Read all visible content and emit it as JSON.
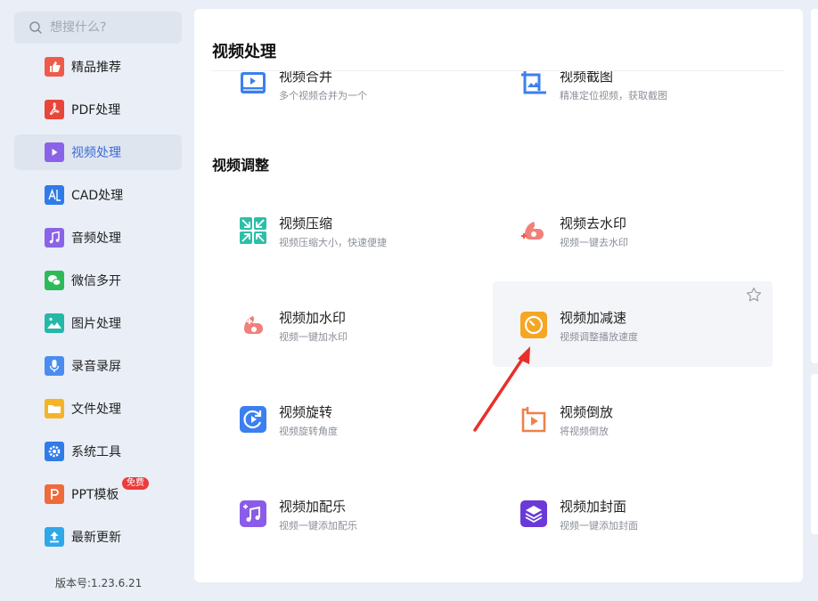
{
  "search": {
    "placeholder": "想搜什么?"
  },
  "sidebar": {
    "items": [
      {
        "label": "精品推荐",
        "icon": "thumbs-up-icon",
        "color": "#f05a4a"
      },
      {
        "label": "PDF处理",
        "icon": "pdf-icon",
        "color": "#e8463a"
      },
      {
        "label": "视频处理",
        "icon": "play-icon",
        "color": "#8a63e8",
        "active": true
      },
      {
        "label": "CAD处理",
        "icon": "cad-icon",
        "color": "#2f7be8"
      },
      {
        "label": "音频处理",
        "icon": "music-note-icon",
        "color": "#8a63e8"
      },
      {
        "label": "微信多开",
        "icon": "wechat-icon",
        "color": "#2fba5a"
      },
      {
        "label": "图片处理",
        "icon": "image-icon",
        "color": "#24b8a8"
      },
      {
        "label": "录音录屏",
        "icon": "microphone-icon",
        "color": "#4a8cf0"
      },
      {
        "label": "文件处理",
        "icon": "folder-icon",
        "color": "#f5b428"
      },
      {
        "label": "系统工具",
        "icon": "gear-icon",
        "color": "#2f7be8"
      },
      {
        "label": "PPT模板",
        "icon": "ppt-icon",
        "color": "#f06a3a",
        "badge": "免费"
      },
      {
        "label": "最新更新",
        "icon": "upload-icon",
        "color": "#2fa8e8"
      }
    ],
    "version": "版本号:1.23.6.21"
  },
  "main": {
    "title": "视频处理",
    "clipped_cards": [
      {
        "name": "视频合并",
        "desc": "多个视频合并为一个",
        "icon": "video-merge-icon"
      },
      {
        "name": "视频截图",
        "desc": "精准定位视频，获取截图",
        "icon": "video-screenshot-icon"
      }
    ],
    "section_title": "视频调整",
    "cards": [
      {
        "name": "视频压缩",
        "desc": "视频压缩大小，快速便捷",
        "icon": "compress-icon"
      },
      {
        "name": "视频去水印",
        "desc": "视频一键去水印",
        "icon": "remove-watermark-icon"
      },
      {
        "name": "视频加水印",
        "desc": "视频一键加水印",
        "icon": "add-watermark-icon"
      },
      {
        "name": "视频加减速",
        "desc": "视频调整播放速度",
        "icon": "speed-icon",
        "hover": true
      },
      {
        "name": "视频旋转",
        "desc": "视频旋转角度",
        "icon": "rotate-icon"
      },
      {
        "name": "视频倒放",
        "desc": "将视频倒放",
        "icon": "reverse-icon"
      },
      {
        "name": "视频加配乐",
        "desc": "视频一键添加配乐",
        "icon": "add-music-icon"
      },
      {
        "name": "视频加封面",
        "desc": "视频一键添加封面",
        "icon": "add-cover-icon"
      }
    ]
  },
  "colors": {
    "accent": "#3a6bd8",
    "annotation_arrow": "#e8302a",
    "background": "#e9eef7"
  }
}
